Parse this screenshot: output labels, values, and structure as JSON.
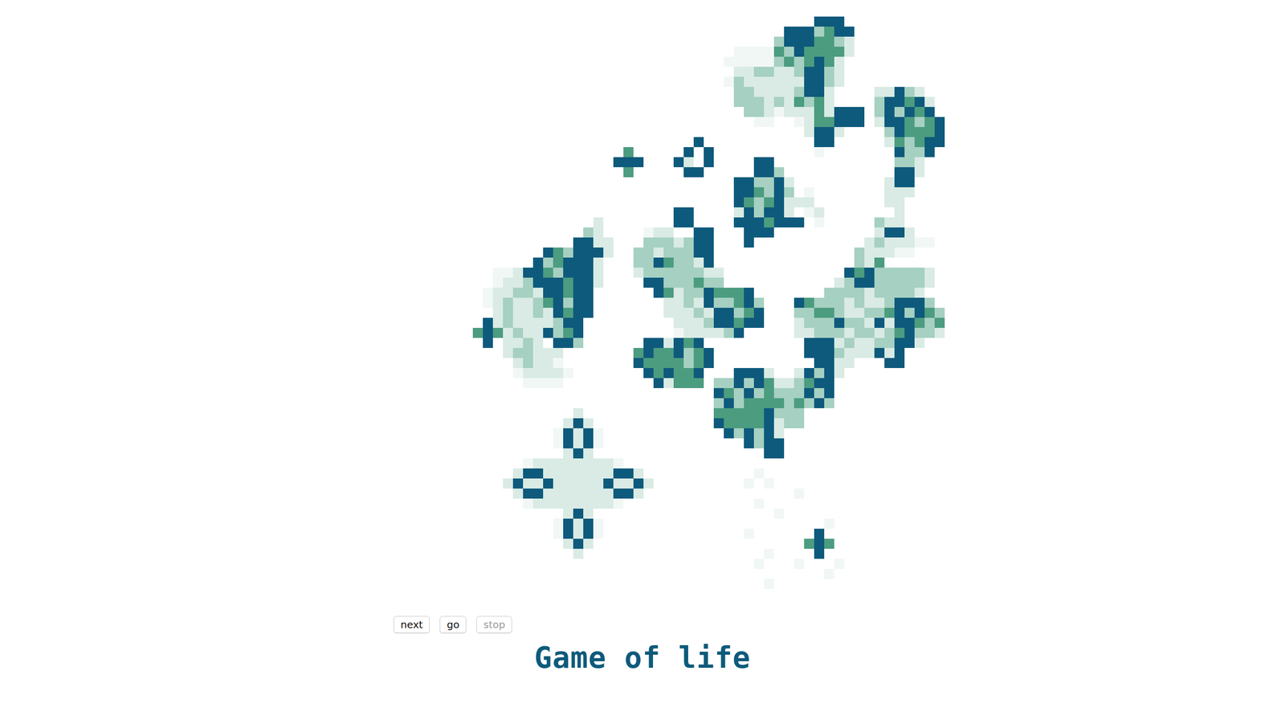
{
  "board": {
    "columns": 48,
    "max_level": 5,
    "rows": [
      "...................................555",
      "................................5553455",
      "...............................35554432",
      "...........................111143544442",
      "..........................111113434542",
      "...........................22332235532",
      "..........................132222225532",
      "...........................3322223552....22532",
      "...........................3332324342....355452",
      "............................332122242555.353545",
      ".............................11..1244555.2554345",
      "..................................2552....354445",
      ".......................5...........55.....243455",
      "................4.....5.5..........1.......5335",
      "...............555...52.5....55............332",
      "................4.....55.....553...........552",
      "...........................553352.........255",
      "...........................554353.1.......222",
      "...........................54345222.......22",
      ".....................55....253552.12.......2",
      ".............2.......55....5554555.1.....322",
      "............32....122..55...555..........2552",
      "...........5522...3332355...5...........2322211",
      "........5435552..33233355..............322211",
      ".......5345552...33543325..............324",
      "...11255435552...233333322............545333332",
      "...12235554552....55333433...........2355333332",
      "..12233255455......5423354445.......3333233332",
      "..12322345355.......2232533453...54333232235553",
      "...2322325455.......2223255345...334432233453543",
      "..5232222355.........222355455...233353325255434",
      ".45423225345.........1222235.....223332332345332",
      "..5.2232.553......552545..........555232233552",
      "....233222.......45445345.........5553222525",
      ".....23221.......54444345..........5522...55",
      ".....122221.......545445...5552..25352",
      "......1111.........52444.335354223455",
      ".........................543534333535",
      ".........................353444434353",
      "...........2.............444445333",
      "..........252............544445233",
      ".........15251............535352",
      ".........15251..............5355",
      "..........252.................55",
      "......1222222221",
      ".....2552222222552...........1",
      "....252252222252252.........1.1",
      ".....2552222222552...............1",
      "......1222222221.............1",
      "..........252..................1",
      ".........15251......................1",
      ".........15251..............1......5",
      "..........252.....................454",
      "...........2..................1....5",
      ".............................1...1...1",
      "....................................1",
      "..............................1",
      "",
      ""
    ]
  },
  "buttons": [
    {
      "label": "next",
      "disabled": false
    },
    {
      "label": "go",
      "disabled": false
    },
    {
      "label": "stop",
      "disabled": true
    }
  ],
  "title": "Game of life"
}
